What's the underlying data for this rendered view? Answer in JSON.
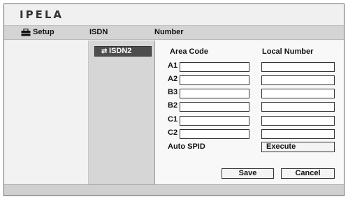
{
  "app": {
    "logo": "IPELA"
  },
  "menubar": {
    "setup_label": "Setup",
    "setup_icon": "toolbox-icon",
    "isdn_label": "ISDN",
    "number_label": "Number"
  },
  "sidebar": {
    "items": [
      {
        "label": "ISDN2",
        "icon": "isdn-icon",
        "selected": true
      }
    ]
  },
  "form": {
    "area_header": "Area Code",
    "local_header": "Local Number",
    "rows": [
      {
        "label": "A1",
        "area_value": "",
        "local_value": ""
      },
      {
        "label": "A2",
        "area_value": "",
        "local_value": ""
      },
      {
        "label": "B3",
        "area_value": "",
        "local_value": ""
      },
      {
        "label": "B2",
        "area_value": "",
        "local_value": ""
      },
      {
        "label": "C1",
        "area_value": "",
        "local_value": ""
      },
      {
        "label": "C2",
        "area_value": "",
        "local_value": ""
      }
    ],
    "autospid_label": "Auto SPID",
    "execute_label": "Execute",
    "save_label": "Save",
    "cancel_label": "Cancel"
  }
}
